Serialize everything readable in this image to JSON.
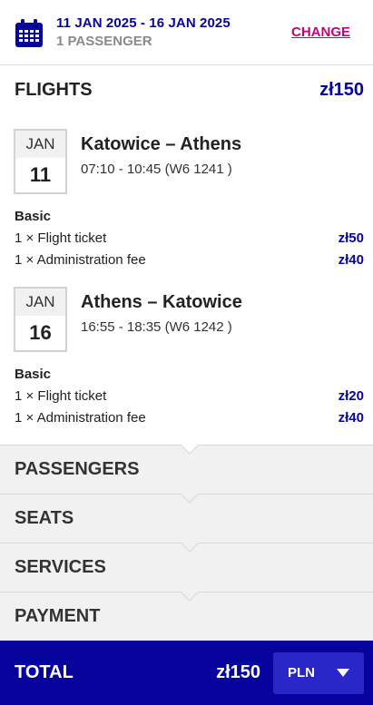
{
  "header": {
    "dates": "11 JAN 2025 - 16 JAN 2025",
    "passengers": "1 PASSENGER",
    "change_label": "CHANGE",
    "icon": "calendar-icon"
  },
  "flights": {
    "title": "FLIGHTS",
    "price": "zł150",
    "items": [
      {
        "month": "JAN",
        "day": "11",
        "route": "Katowice – Athens",
        "times": "07:10 - 10:45 (W6 1241 )",
        "fare": "Basic",
        "lines": [
          {
            "label": "1 × Flight ticket",
            "amount": "zł50"
          },
          {
            "label": "1 × Administration fee",
            "amount": "zł40"
          }
        ]
      },
      {
        "month": "JAN",
        "day": "16",
        "route": "Athens – Katowice",
        "times": "16:55 - 18:35 (W6 1242 )",
        "fare": "Basic",
        "lines": [
          {
            "label": "1 × Flight ticket",
            "amount": "zł20"
          },
          {
            "label": "1 × Administration fee",
            "amount": "zł40"
          }
        ]
      }
    ]
  },
  "sections": {
    "passengers": "PASSENGERS",
    "seats": "SEATS",
    "services": "SERVICES",
    "payment": "PAYMENT"
  },
  "total": {
    "label": "TOTAL",
    "amount": "zł150",
    "currency": "PLN"
  },
  "colors": {
    "brand": "#06049d",
    "accent": "#c6007e",
    "currency_button": "#2a27c8"
  }
}
